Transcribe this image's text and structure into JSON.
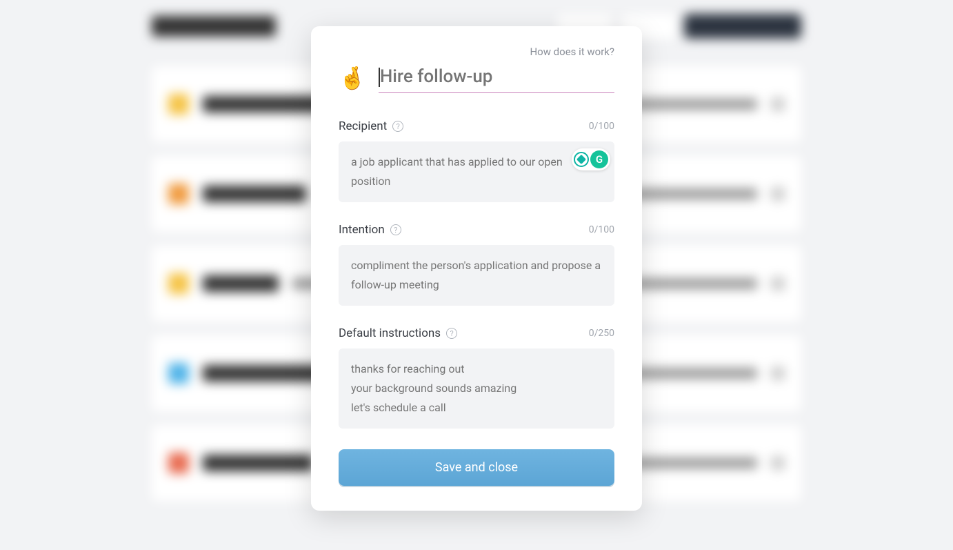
{
  "modal": {
    "how_link": "How does it work?",
    "emoji": "🤞",
    "title_placeholder": "Hire follow-up",
    "fields": {
      "recipient": {
        "label": "Recipient",
        "count": "0/100",
        "placeholder": "a job applicant that has applied to our open position"
      },
      "intention": {
        "label": "Intention",
        "count": "0/100",
        "placeholder": "compliment the person's application and propose a follow-up meeting"
      },
      "instructions": {
        "label": "Default instructions",
        "count": "0/250",
        "placeholder": "thanks for reaching out\nyour background sounds amazing\nlet's schedule a call"
      }
    },
    "save_label": "Save and close",
    "grammarly_letter": "G"
  }
}
